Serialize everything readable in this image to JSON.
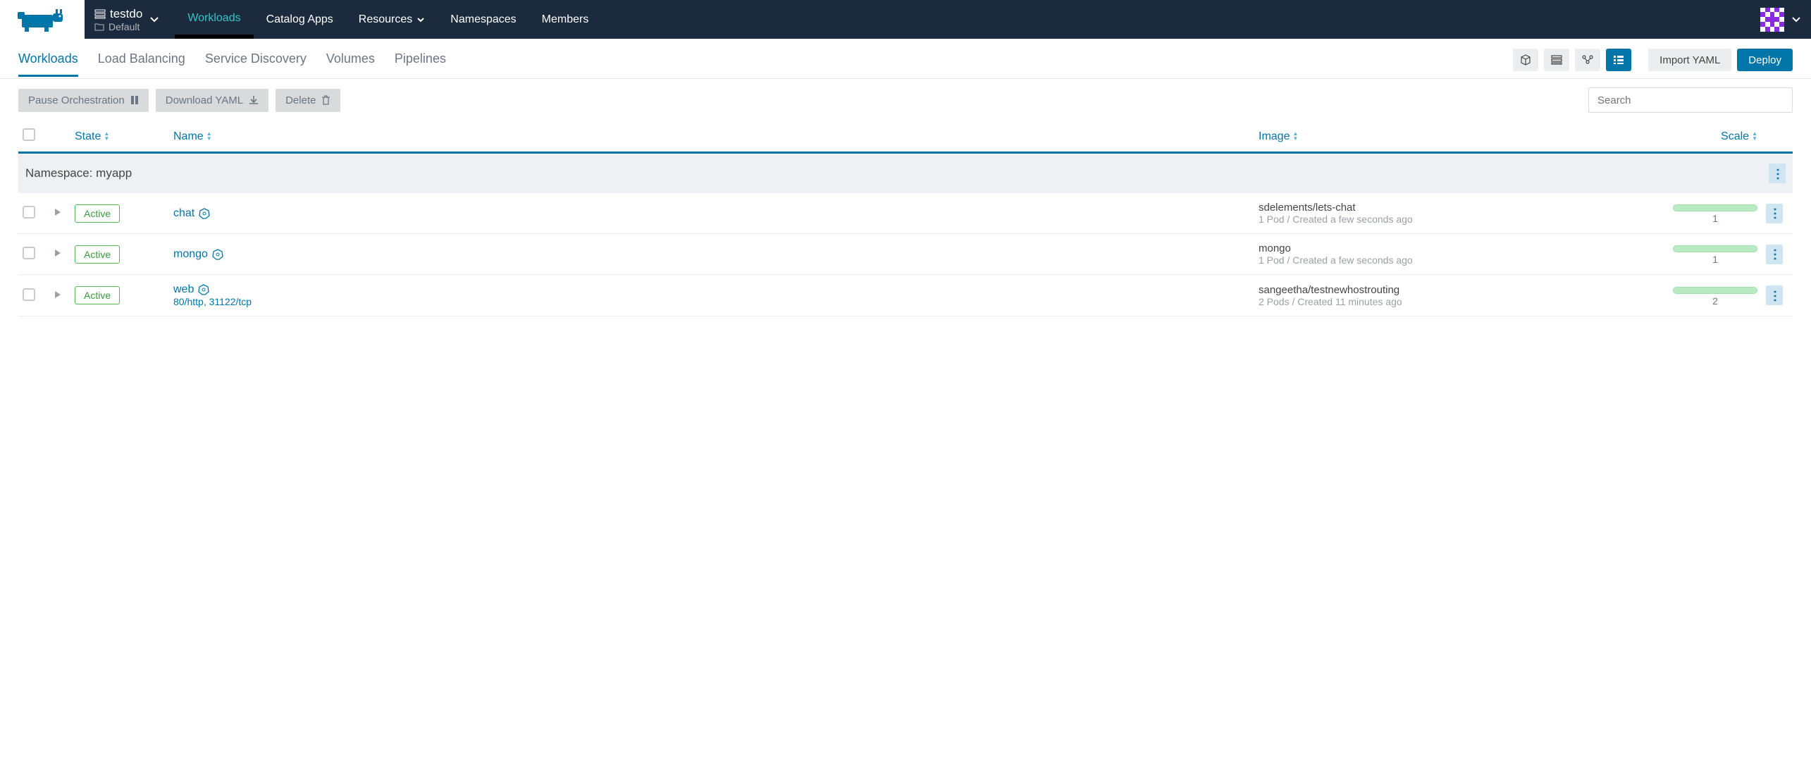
{
  "project": {
    "name": "testdo",
    "namespace": "Default"
  },
  "topnav": [
    {
      "label": "Workloads",
      "active": true
    },
    {
      "label": "Catalog Apps"
    },
    {
      "label": "Resources",
      "caret": true
    },
    {
      "label": "Namespaces"
    },
    {
      "label": "Members"
    }
  ],
  "subnav": [
    {
      "label": "Workloads",
      "active": true
    },
    {
      "label": "Load Balancing"
    },
    {
      "label": "Service Discovery"
    },
    {
      "label": "Volumes"
    },
    {
      "label": "Pipelines"
    }
  ],
  "buttons": {
    "import_yaml": "Import YAML",
    "deploy": "Deploy",
    "pause_orchestration": "Pause Orchestration",
    "download_yaml": "Download YAML",
    "delete": "Delete"
  },
  "search": {
    "placeholder": "Search"
  },
  "columns": {
    "state": "State",
    "name": "Name",
    "image": "Image",
    "scale": "Scale"
  },
  "group": {
    "label": "Namespace: myapp"
  },
  "rows": [
    {
      "state": "Active",
      "name": "chat",
      "ports": "",
      "image": "sdelements/lets-chat",
      "meta": "1 Pod / Created a few seconds ago",
      "scale": "1"
    },
    {
      "state": "Active",
      "name": "mongo",
      "ports": "",
      "image": "mongo",
      "meta": "1 Pod / Created a few seconds ago",
      "scale": "1"
    },
    {
      "state": "Active",
      "name": "web",
      "ports_a": "80/http",
      "ports_sep": ", ",
      "ports_b": "31122/tcp",
      "image": "sangeetha/testnewhostrouting",
      "meta": "2 Pods / Created 11 minutes ago",
      "scale": "2"
    }
  ]
}
